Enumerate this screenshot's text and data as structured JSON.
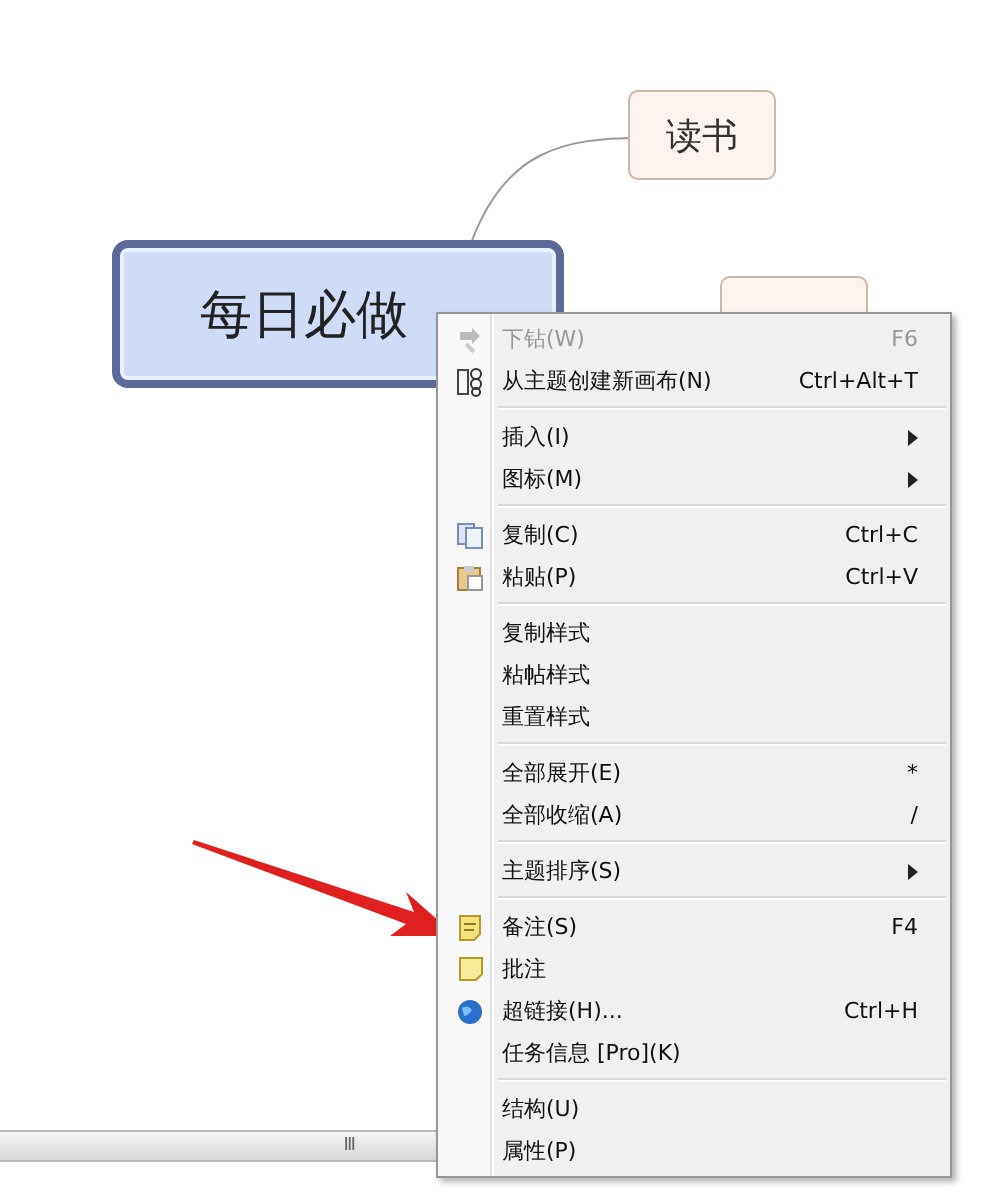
{
  "mindmap": {
    "central_topic": "每日必做",
    "subtopics": [
      {
        "label": "读书"
      }
    ]
  },
  "context_menu": {
    "groups": [
      [
        {
          "label": "下钻(W)",
          "shortcut": "F6",
          "submenu": false,
          "disabled": true,
          "kind": "drill"
        },
        {
          "label": "从主题创建新画布(N)",
          "shortcut": "Ctrl+Alt+T",
          "submenu": false,
          "disabled": false,
          "kind": "canvas"
        }
      ],
      [
        {
          "label": "插入(I)",
          "submenu": true,
          "disabled": false,
          "kind": "plain"
        },
        {
          "label": "图标(M)",
          "submenu": true,
          "disabled": false,
          "kind": "plain"
        }
      ],
      [
        {
          "label": "复制(C)",
          "shortcut": "Ctrl+C",
          "submenu": false,
          "disabled": false,
          "kind": "copy"
        },
        {
          "label": "粘贴(P)",
          "shortcut": "Ctrl+V",
          "submenu": false,
          "disabled": false,
          "kind": "paste"
        }
      ],
      [
        {
          "label": "复制样式",
          "submenu": false,
          "disabled": false,
          "kind": "plain"
        },
        {
          "label": "粘帖样式",
          "submenu": false,
          "disabled": false,
          "kind": "plain"
        },
        {
          "label": "重置样式",
          "submenu": false,
          "disabled": false,
          "kind": "plain"
        }
      ],
      [
        {
          "label": "全部展开(E)",
          "shortcut": "*",
          "submenu": false,
          "disabled": false,
          "kind": "plain"
        },
        {
          "label": "全部收缩(A)",
          "shortcut": "/",
          "submenu": false,
          "disabled": false,
          "kind": "plain"
        }
      ],
      [
        {
          "label": "主题排序(S)",
          "submenu": true,
          "disabled": false,
          "kind": "plain"
        }
      ],
      [
        {
          "label": "备注(S)",
          "shortcut": "F4",
          "submenu": false,
          "disabled": false,
          "kind": "note"
        },
        {
          "label": "批注",
          "submenu": false,
          "disabled": false,
          "kind": "comment"
        },
        {
          "label": "超链接(H)...",
          "shortcut": "Ctrl+H",
          "submenu": false,
          "disabled": false,
          "kind": "link"
        },
        {
          "label": "任务信息 [Pro](K)",
          "submenu": false,
          "disabled": false,
          "kind": "plain"
        }
      ],
      [
        {
          "label": "结构(U)",
          "submenu": false,
          "disabled": false,
          "kind": "plain"
        },
        {
          "label": "属性(P)",
          "submenu": false,
          "disabled": false,
          "kind": "plain"
        }
      ]
    ]
  },
  "scrollbar": {
    "grip": "Ⅲ"
  }
}
